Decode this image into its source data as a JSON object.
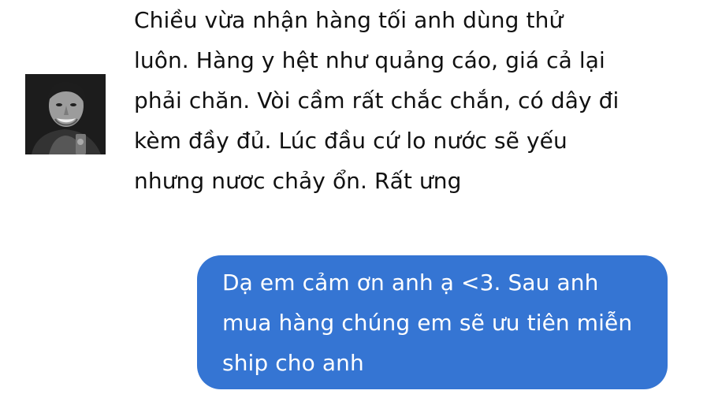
{
  "conversation": {
    "incoming": {
      "avatar_icon": "person-avatar-icon",
      "lines": [
        "Chiều vừa nhận hàng tối anh dùng thử",
        "luôn. Hàng y hệt như quảng cáo, giá cả lại",
        "phải chăn. Vòi cầm rất chắc chắn, có dây đi",
        "kèm đầy đủ. Lúc đầu cứ lo nước sẽ yếu",
        "nhưng nươc chảy ổn. Rất ưng"
      ]
    },
    "outgoing": {
      "bubble_color": "#3575d3",
      "lines": [
        "Dạ em cảm ơn anh ạ <3. Sau anh",
        "mua hàng chúng em sẽ ưu tiên miễn",
        "ship cho anh"
      ]
    }
  }
}
